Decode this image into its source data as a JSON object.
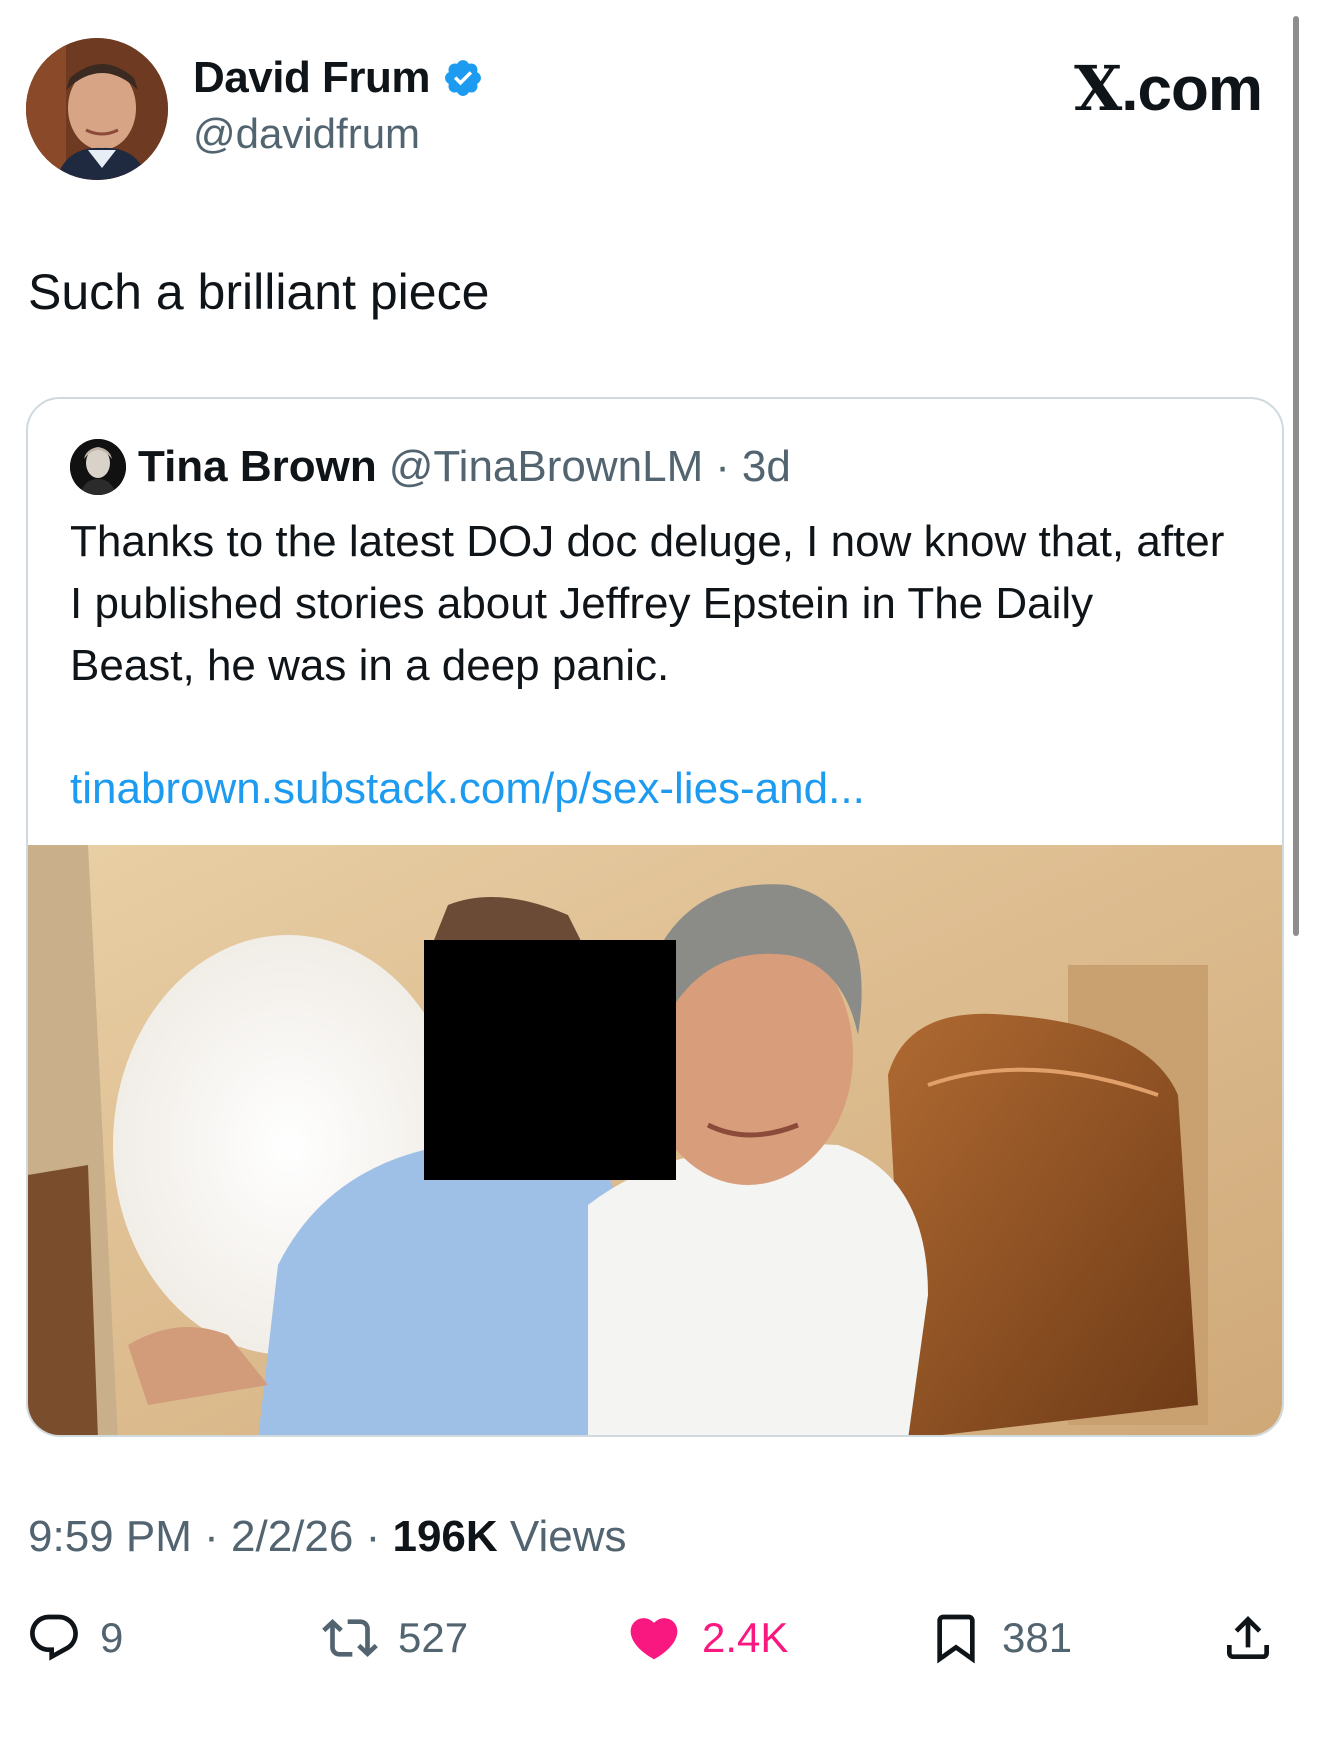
{
  "author": {
    "name": "David Frum",
    "handle": "@davidfrum",
    "verified": true
  },
  "brand": {
    "x": "X",
    "domain": ".com"
  },
  "tweet": {
    "text": "Such a brilliant piece"
  },
  "quote": {
    "name": "Tina Brown",
    "handle": "@TinaBrownLM",
    "separator": "·",
    "age": "3d",
    "text": "Thanks to the latest DOJ doc deluge, I now know that, after I published stories about Jeffrey Epstein in The Daily Beast, he was in a deep panic.",
    "link": "tinabrown.substack.com/p/sex-lies-and..."
  },
  "meta": {
    "time": "9:59 PM",
    "sep1": "·",
    "date": "2/2/26",
    "sep2": "·",
    "views_count": "196K",
    "views_label": "Views"
  },
  "actions": {
    "replies": "9",
    "reposts": "527",
    "likes": "2.4K",
    "bookmarks": "381"
  },
  "colors": {
    "link": "#1d9bf0",
    "like": "#f91880",
    "muted": "#536471",
    "verified": "#1d9bf0"
  }
}
